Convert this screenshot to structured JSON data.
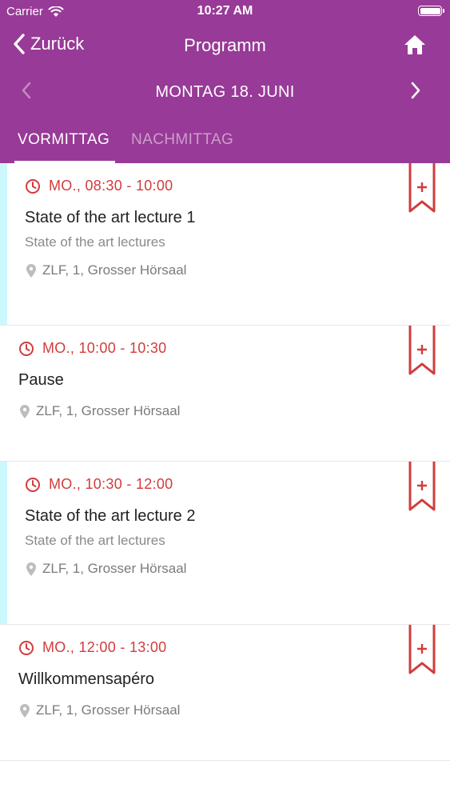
{
  "status_bar": {
    "carrier": "Carrier",
    "time": "10:27 AM"
  },
  "navbar": {
    "back_label": "Zurück",
    "title": "Programm"
  },
  "day_selector": {
    "label": "MONTAG 18. JUNI"
  },
  "tabs": [
    {
      "label": "VORMITTAG",
      "active": true
    },
    {
      "label": "NACHMITTAG",
      "active": false
    }
  ],
  "colors": {
    "header": "#983a97",
    "accent_red": "#d23c3c",
    "highlight": "#cbf8fc"
  },
  "sessions": [
    {
      "time": "MO., 08:30 - 10:00",
      "title": "State of the art lecture 1",
      "subtitle": "State of the art lectures",
      "location": "ZLF, 1, Grosser Hörsaal"
    },
    {
      "time": "MO., 10:00 - 10:30",
      "title": "Pause",
      "subtitle": "",
      "location": "ZLF, 1, Grosser Hörsaal"
    },
    {
      "time": "MO., 10:30 - 12:00",
      "title": "State of the art lecture 2",
      "subtitle": "State of the art lectures",
      "location": "ZLF, 1, Grosser Hörsaal"
    },
    {
      "time": "MO., 12:00 - 13:00",
      "title": "Willkommensapéro",
      "subtitle": "",
      "location": "ZLF, 1, Grosser Hörsaal"
    }
  ]
}
